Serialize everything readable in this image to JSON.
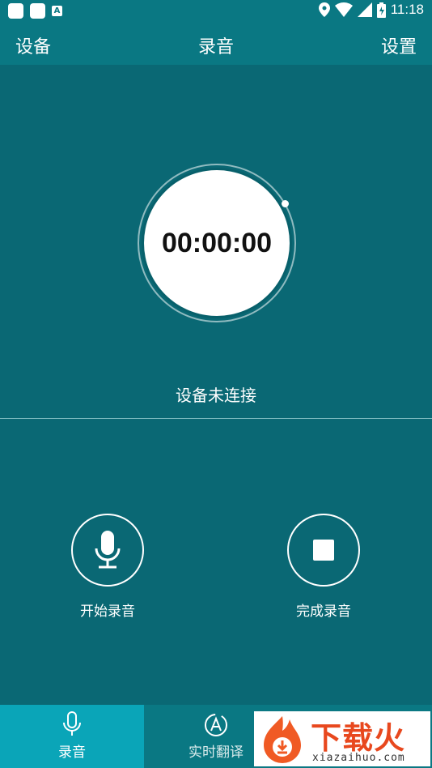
{
  "status_bar": {
    "time": "11:18",
    "left_icons": [
      "app-icon",
      "app-icon",
      "a-app-icon"
    ],
    "right_icons": [
      "location-icon",
      "wifi-icon",
      "signal-icon",
      "battery-icon"
    ],
    "a_glyph": "A"
  },
  "app_bar": {
    "left_label": "设备",
    "title": "录音",
    "right_label": "设置"
  },
  "timer": {
    "time_display": "00:00:00"
  },
  "connection_status": "设备未连接",
  "actions": {
    "start_label": "开始录音",
    "finish_label": "完成录音"
  },
  "bottom_nav": {
    "items": [
      {
        "label": "录音",
        "icon": "microphone-icon",
        "active": true
      },
      {
        "label": "实时翻译",
        "icon": "translate-icon",
        "active": false
      }
    ]
  },
  "watermark": {
    "brand": "下载火",
    "url_text": "xiazaihuo.com"
  },
  "colors": {
    "background": "#0a6874",
    "app_bar": "#0a7883",
    "active_tab": "#0aa5b8",
    "watermark_red": "#e8481e"
  }
}
